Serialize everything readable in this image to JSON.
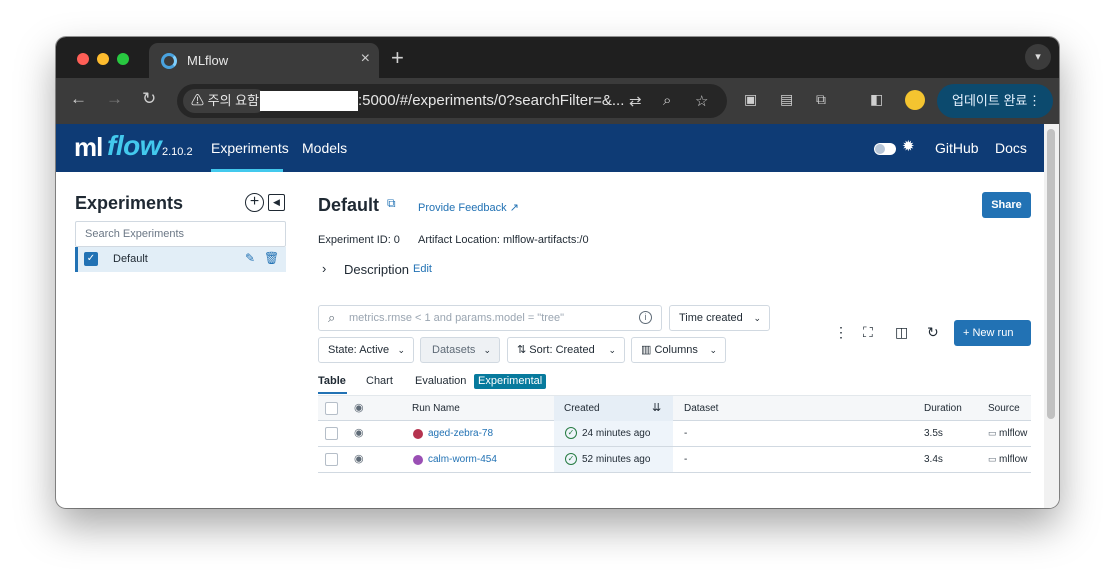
{
  "browser": {
    "tab_title": "MLflow",
    "tab_close": "×",
    "new_tab": "+",
    "tab_menu": "▾",
    "security_chip": "주의 요함",
    "url_suffix": ":5000/#/experiments/0?searchFilter=&...",
    "update_button": "업데이트 완료",
    "traffic_lights": [
      "#ff5f57",
      "#febc2e",
      "#28c840"
    ]
  },
  "header": {
    "logo_ml": "ml",
    "logo_flow": "flow",
    "version": "2.10.2",
    "nav": [
      "Experiments",
      "Models"
    ],
    "right_links": [
      "GitHub",
      "Docs"
    ],
    "brand_color": "#0e3b75",
    "accent_color": "#43c9ed"
  },
  "sidebar": {
    "title": "Experiments",
    "search_placeholder": "Search Experiments",
    "items": [
      {
        "label": "Default",
        "checked": true
      }
    ]
  },
  "main": {
    "title": "Default",
    "feedback_link": "Provide Feedback",
    "share_button": "Share",
    "experiment_id": "Experiment ID: 0",
    "artifact_location": "Artifact Location: mlflow-artifacts:/0",
    "description_label": "Description",
    "description_edit": "Edit",
    "search_placeholder": "metrics.rmse < 1 and params.model = \"tree\"",
    "time_filter": "Time created",
    "state_filter": "State: Active",
    "datasets_filter": "Datasets",
    "sort_filter": "Sort: Created",
    "columns_button": "Columns",
    "new_run_button": "New run",
    "tabs": [
      "Table",
      "Chart",
      "Evaluation"
    ],
    "experimental_badge": "Experimental",
    "primary_color": "#2272b4"
  },
  "table": {
    "columns": [
      "Run Name",
      "Created",
      "Dataset",
      "Duration",
      "Source"
    ],
    "rows": [
      {
        "run_name": "aged-zebra-78",
        "color": "#b5334f",
        "created": "24 minutes ago",
        "dataset": "-",
        "duration": "3.5s",
        "source": "mlflow"
      },
      {
        "run_name": "calm-worm-454",
        "color": "#9a4fb4",
        "created": "52 minutes ago",
        "dataset": "-",
        "duration": "3.4s",
        "source": "mlflow"
      }
    ]
  }
}
